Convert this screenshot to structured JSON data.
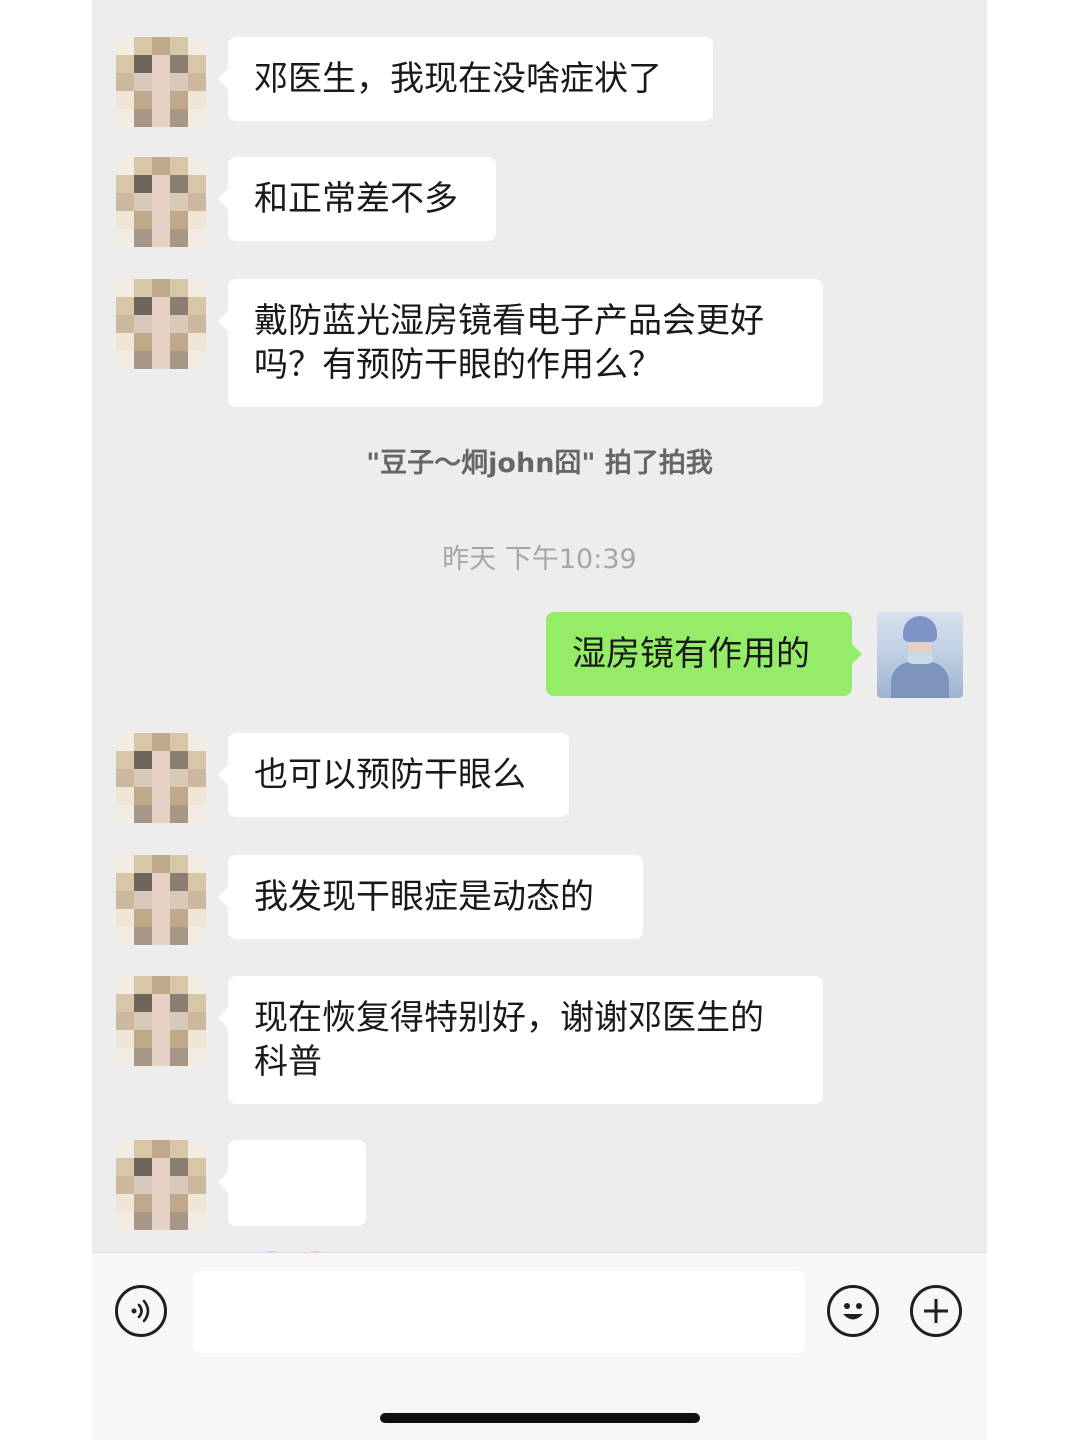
{
  "messages": [
    {
      "side": "left",
      "text": "邓医生，我现在没啥症状了"
    },
    {
      "side": "left",
      "text": "和正常差不多"
    },
    {
      "side": "left",
      "text": "戴防蓝光湿房镜看电子产品会更好\n吗？有预防干眼的作用么？"
    },
    {
      "side": "system",
      "text": "\"豆子～炯john囧\" 拍了拍我"
    },
    {
      "side": "time",
      "text": "昨天 下午10:39"
    },
    {
      "side": "right",
      "text": "湿房镜有作用的"
    },
    {
      "side": "left",
      "text": "也可以预防干眼么"
    },
    {
      "side": "left",
      "text": "我发现干眼症是动态的"
    },
    {
      "side": "left",
      "text": "现在恢复得特别好，谢谢邓医生的\n科普"
    },
    {
      "side": "left",
      "emoji": [
        "smirk-emoji",
        "smirk-emoji"
      ]
    }
  ],
  "input_bar": {
    "voice_icon": "voice-icon",
    "emoji_icon": "emoji-face-icon",
    "plus_icon": "plus-icon",
    "text_value": ""
  },
  "colors": {
    "background": "#ededed",
    "bubble_left": "#ffffff",
    "bubble_right": "#95ec69"
  }
}
